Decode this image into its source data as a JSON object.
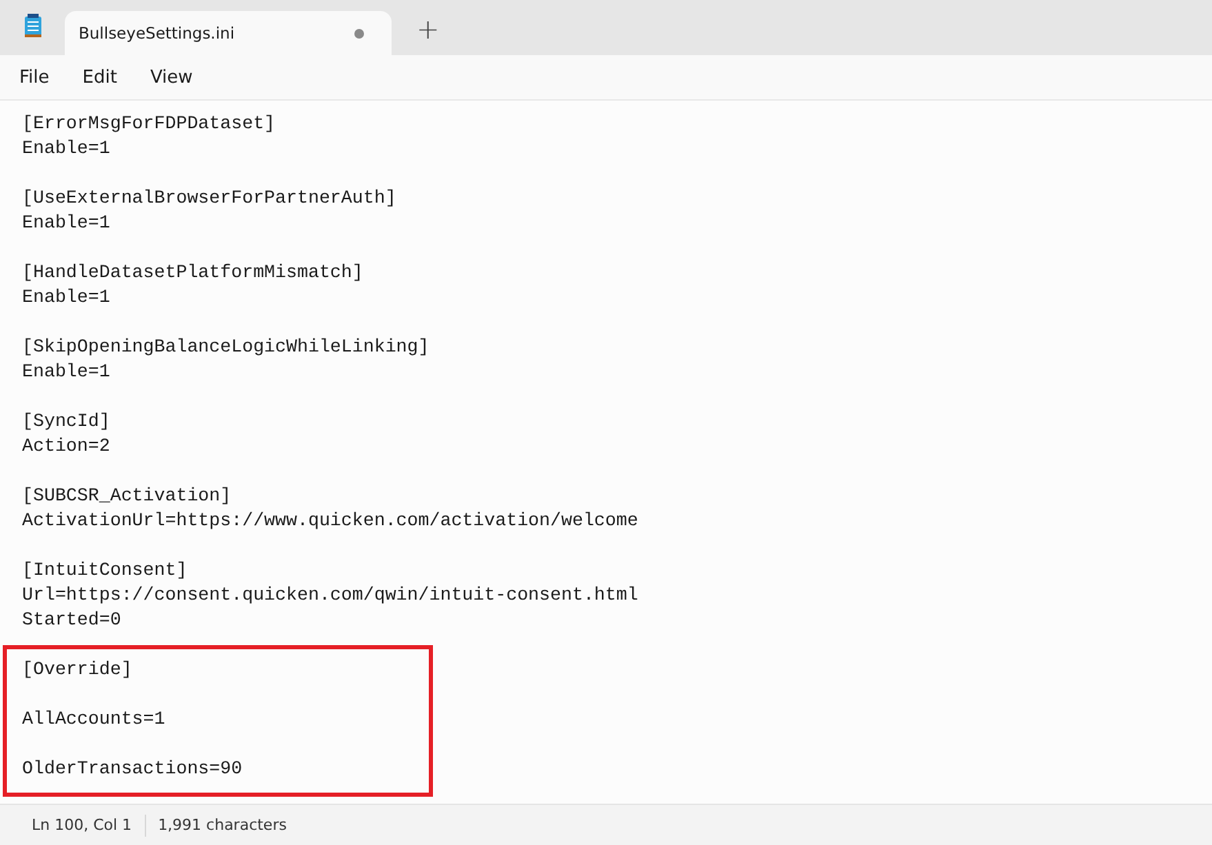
{
  "window": {
    "tab_title": "BullseyeSettings.ini",
    "tab_unsaved": true,
    "new_tab": "+"
  },
  "menu": [
    "File",
    "Edit",
    "View"
  ],
  "editor": {
    "groups": [
      {
        "highlighted": false,
        "sections": [
          [
            "[ErrorMsgForFDPDataset]",
            "Enable=1"
          ],
          [
            "[UseExternalBrowserForPartnerAuth]",
            "Enable=1"
          ],
          [
            "[HandleDatasetPlatformMismatch]",
            "Enable=1"
          ],
          [
            "[SkipOpeningBalanceLogicWhileLinking]",
            "Enable=1"
          ],
          [
            "[SyncId]",
            "Action=2"
          ],
          [
            "[SUBCSR_Activation]",
            "ActivationUrl=https://www.quicken.com/activation/welcome"
          ],
          [
            "[IntuitConsent]",
            "Url=https://consent.quicken.com/qwin/intuit-consent.html",
            "Started=0"
          ]
        ]
      },
      {
        "highlighted": true,
        "sections": [
          [
            "[Override]"
          ],
          [
            "AllAccounts=1"
          ],
          [
            "OlderTransactions=90"
          ]
        ]
      }
    ]
  },
  "status_bar": {
    "position": "Ln 100, Col 1",
    "characters": "1,991 characters"
  }
}
